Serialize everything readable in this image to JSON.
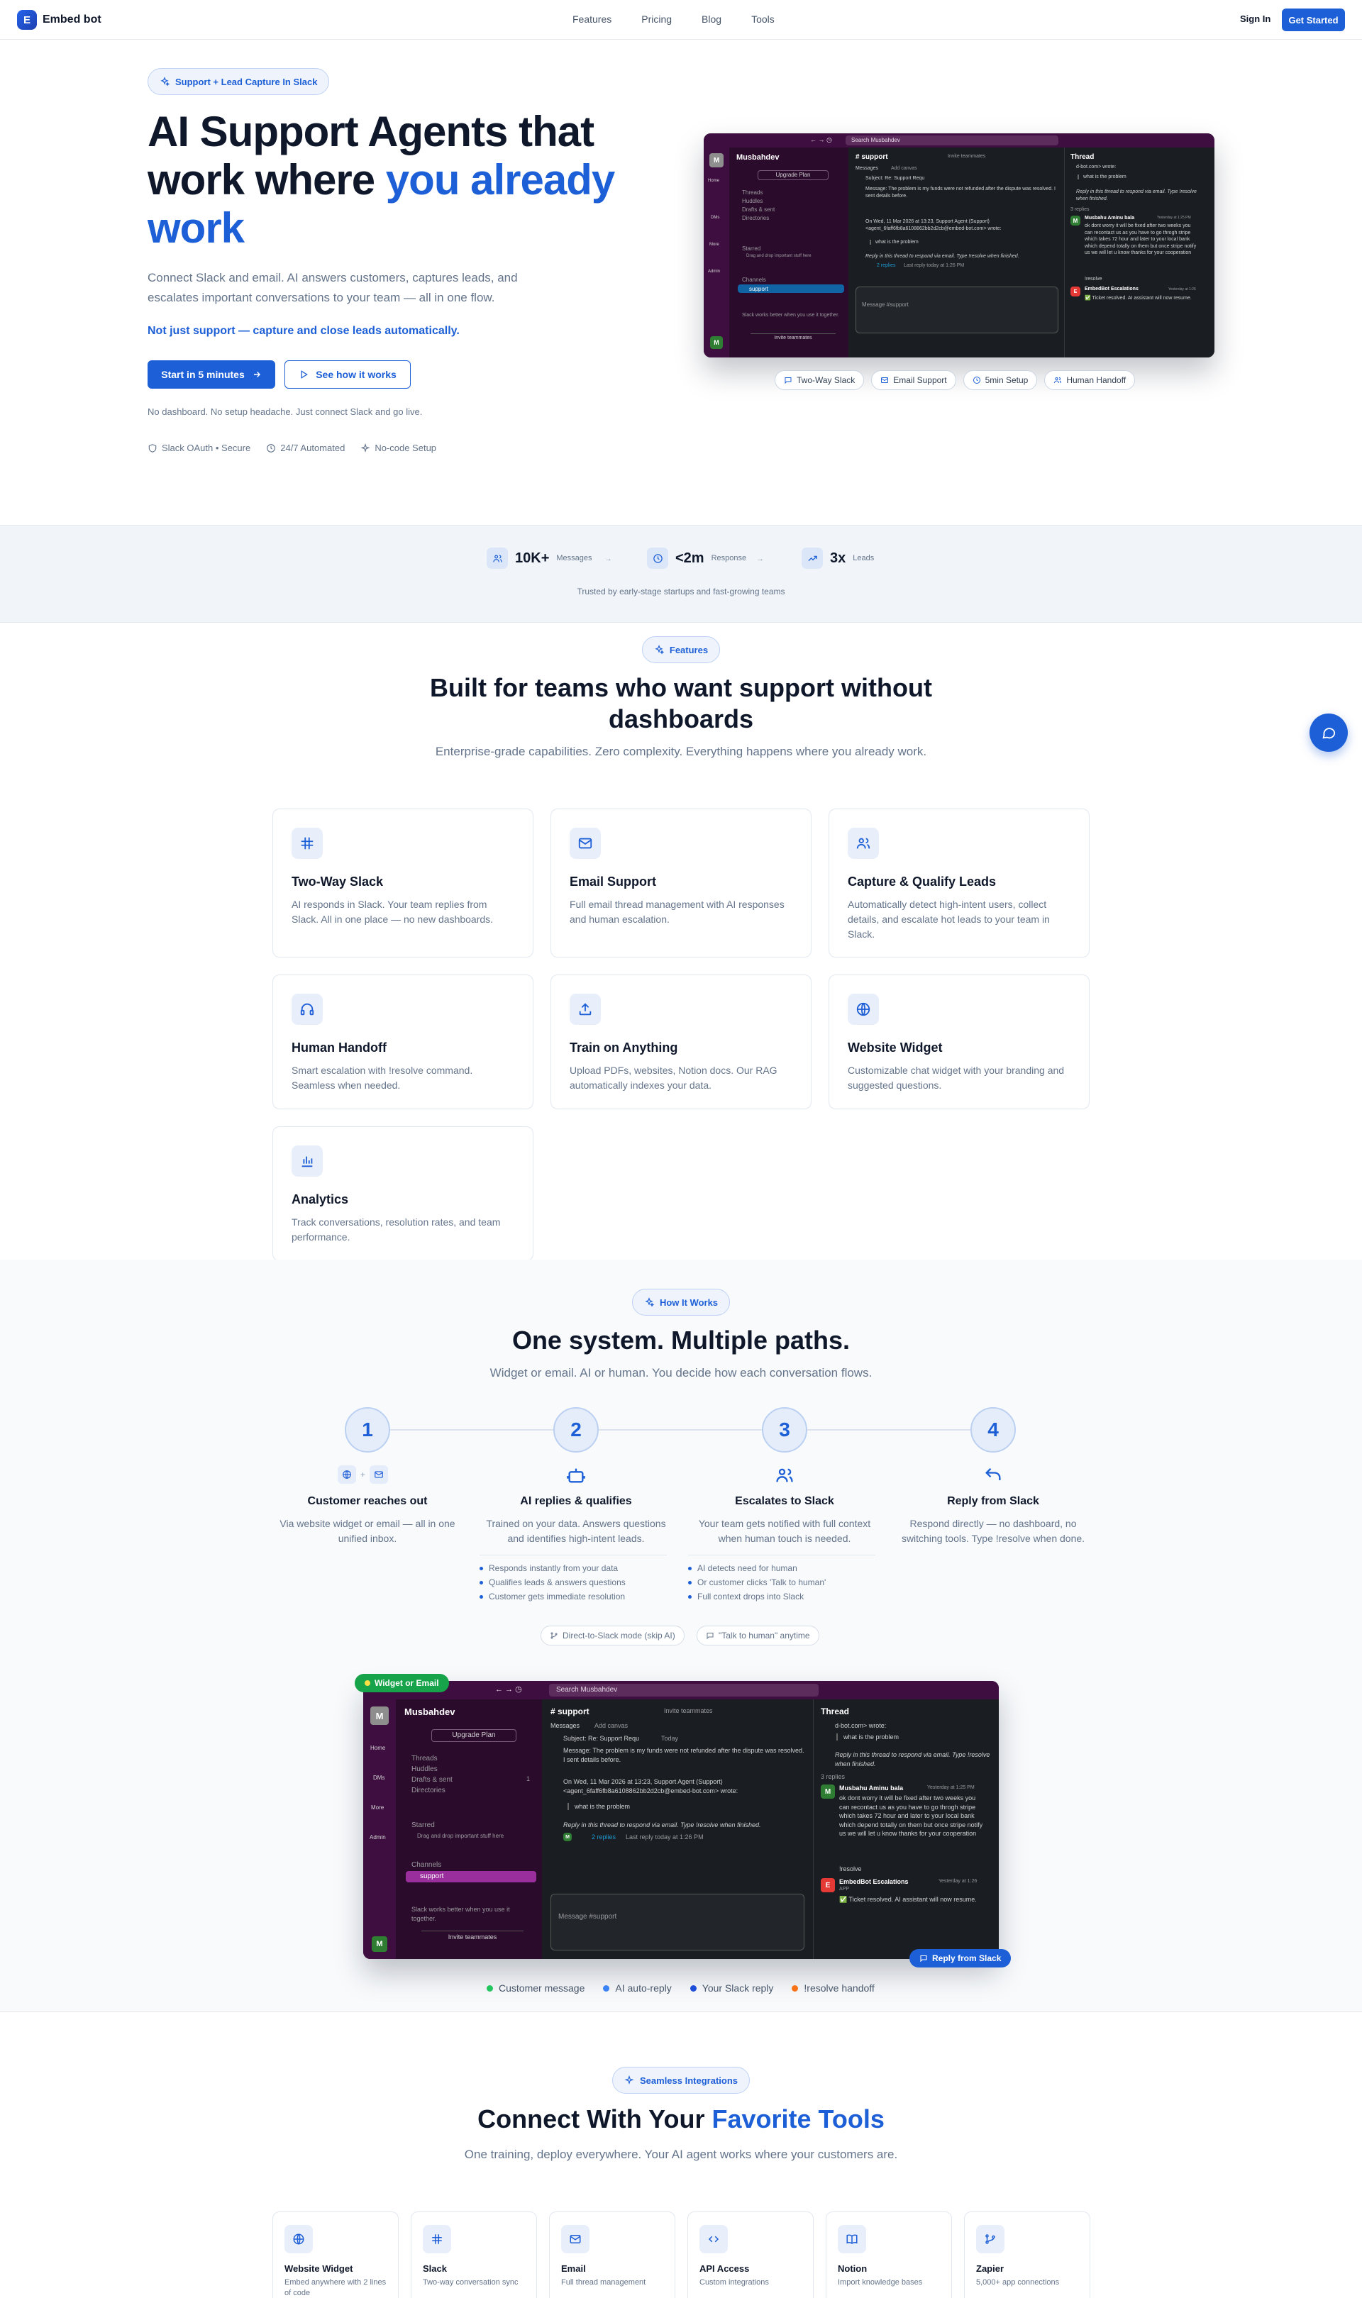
{
  "nav": {
    "brand": "Embed bot",
    "links": [
      "Features",
      "Pricing",
      "Blog",
      "Tools"
    ],
    "signin": "Sign In",
    "cta": "Get Started"
  },
  "hero": {
    "badge": "Support + Lead Capture In Slack",
    "title_line1": "AI Support Agents that",
    "title_line2a": "work where ",
    "title_line2b": "you already",
    "title_line3": "work",
    "description": "Connect Slack and email. AI answers customers, captures leads, and escalates important conversations to your team — all in one flow.",
    "accent": "Not just support — capture and close leads automatically.",
    "primary_button": "Start in 5 minutes",
    "secondary_button": "See how it works",
    "note": "No dashboard. No setup headache. Just connect Slack and go live.",
    "trust": [
      "Slack OAuth • Secure",
      "24/7 Automated",
      "No-code Setup"
    ],
    "chips": [
      "Two-Way Slack",
      "Email Support",
      "5min Setup",
      "Human Handoff"
    ]
  },
  "slack": {
    "search": "Search Musbahdev",
    "workspace": "Musbahdev",
    "upgrade": "Upgrade Plan",
    "nav": [
      "Threads",
      "Huddles",
      "Drafts & sent",
      "Directories"
    ],
    "rail": [
      "Home",
      "DMs",
      "More",
      "Admin"
    ],
    "drafts_count": "1",
    "starred": "Starred",
    "starred_hint": "Drag and drop important stuff here",
    "channels": "Channels",
    "channel": "support",
    "promo": "Slack works better when you use it together.",
    "invite": "Invite teammates",
    "channel_title": "# support",
    "invite_header": "Invite teammates",
    "tabs": [
      "Messages",
      "Add canvas"
    ],
    "subject": "Subject: Re: Support Requ",
    "today": "Today",
    "msg1": "Message: The problem is my funds were not refunded after the dispute was resolved. I",
    "msg1b": "sent details before.",
    "msg2": "On Wed, 11 Mar 2026 at 13:23, Support Agent (Support) <",
    "msg2b": "agent_6faff6fb8a6108862bb2d2cb@embed-bot.com> wrote:",
    "quote": "what is the problem",
    "reply_hint": "Reply in this thread to respond via email. Type !resolve when finished.",
    "replies": "2 replies",
    "last_reply": "Last reply today at 1:26 PM",
    "composer": "Message #support",
    "thread_title": "Thread",
    "thread_top": "d-bot.com> wrote:",
    "thread_quote": "what is the problem",
    "thread_hint": "Reply in this thread to respond via email. Type !resolve when finished.",
    "replies_count": "3 replies",
    "reply_author": "Musbahu Aminu bala",
    "reply_time": "Yesterday at 1:25 PM",
    "reply_text": "ok dont worry it will be fixed after two weeks you can recontact us as you have to go throgh stripe which takes 72 hour and later to your local bank which depend totally on them but once stripe notify us we will let u know thanks for your cooperation",
    "resolve": "!resolve",
    "bot_author": "EmbedBot Escalations",
    "bot_tag": "APP",
    "bot_time": "Yesterday at 1:26",
    "bot_text": "✅ Ticket resolved. AI assistant will now resume."
  },
  "stats": {
    "items": [
      {
        "value": "10K+",
        "label": "Messages"
      },
      {
        "value": "<2m",
        "label": "Response"
      },
      {
        "value": "3x",
        "label": "Leads"
      }
    ],
    "arrow": "→",
    "note": "Trusted by early-stage startups and fast-growing teams"
  },
  "features": {
    "badge": "Features",
    "title_line1": "Built for teams who want support without",
    "title_line2": "dashboards",
    "subtitle": "Enterprise-grade capabilities. Zero complexity. Everything happens where you already work.",
    "cards": [
      {
        "icon": "slack-icon",
        "title": "Two-Way Slack",
        "desc": "AI responds in Slack. Your team replies from Slack. All in one place — no new dashboards."
      },
      {
        "icon": "mail-icon",
        "title": "Email Support",
        "desc": "Full email thread management with AI responses and human escalation."
      },
      {
        "icon": "users-icon",
        "title": "Capture & Qualify Leads",
        "desc": "Automatically detect high-intent users, collect details, and escalate hot leads to your team in Slack."
      },
      {
        "icon": "headphones-icon",
        "title": "Human Handoff",
        "desc": "Smart escalation with !resolve command. Seamless when needed."
      },
      {
        "icon": "upload-icon",
        "title": "Train on Anything",
        "desc": "Upload PDFs, websites, Notion docs. Our RAG automatically indexes your data."
      },
      {
        "icon": "globe-icon",
        "title": "Website Widget",
        "desc": "Customizable chat widget with your branding and suggested questions."
      },
      {
        "icon": "bar-chart-icon",
        "title": "Analytics",
        "desc": "Track conversations, resolution rates, and team performance."
      }
    ]
  },
  "how": {
    "badge": "How It Works",
    "title": "One system. Multiple paths.",
    "subtitle": "Widget or email. AI or human. You decide how each conversation flows.",
    "steps": [
      {
        "num": "1",
        "title": "Customer reaches out",
        "desc": "Via website widget or email — all in one unified inbox."
      },
      {
        "num": "2",
        "title": "AI replies & qualifies",
        "desc": "Trained on your data. Answers questions and identifies high-intent leads."
      },
      {
        "num": "3",
        "title": "Escalates to Slack",
        "desc": "Your team gets notified with full context when human touch is needed."
      },
      {
        "num": "4",
        "title": "Reply from Slack",
        "desc": "Respond directly — no dashboard, no switching tools. Type !resolve when done."
      }
    ],
    "plus": "+",
    "bullets2": [
      "Responds instantly from your data",
      "Qualifies leads & answers questions",
      "Customer gets immediate resolution"
    ],
    "bullets3": [
      "AI detects need for human",
      "Or customer clicks 'Talk to human'",
      "Full context drops into Slack"
    ],
    "pills": [
      "Direct-to-Slack mode (skip AI)",
      "\"Talk to human\" anytime"
    ],
    "widget_tag": "Widget or Email",
    "reply_tag": "Reply from Slack",
    "legend": [
      {
        "label": "Customer message",
        "color": "#22c55e"
      },
      {
        "label": "AI auto-reply",
        "color": "#3b82f6"
      },
      {
        "label": "Your Slack reply",
        "color": "#1d4ed8"
      },
      {
        "label": "!resolve handoff",
        "color": "#f97316"
      }
    ]
  },
  "integrations": {
    "badge": "Seamless Integrations",
    "title_a": "Connect With Your ",
    "title_b": "Favorite Tools",
    "subtitle": "One training, deploy everywhere. Your AI agent works where your customers are.",
    "cards": [
      {
        "icon": "globe-icon",
        "title": "Website Widget",
        "desc": "Embed anywhere with 2 lines of code"
      },
      {
        "icon": "slack-icon",
        "title": "Slack",
        "desc": "Two-way conversation sync"
      },
      {
        "icon": "mail-icon",
        "title": "Email",
        "desc": "Full thread management"
      },
      {
        "icon": "code-icon",
        "title": "API Access",
        "desc": "Custom integrations"
      },
      {
        "icon": "book-icon",
        "title": "Notion",
        "desc": "Import knowledge bases"
      },
      {
        "icon": "zapier-icon",
        "title": "Zapier",
        "desc": "5,000+ app connections"
      }
    ]
  },
  "colors": {
    "brand": "#1d5fd6",
    "slack_purple": "#3f0e40"
  }
}
